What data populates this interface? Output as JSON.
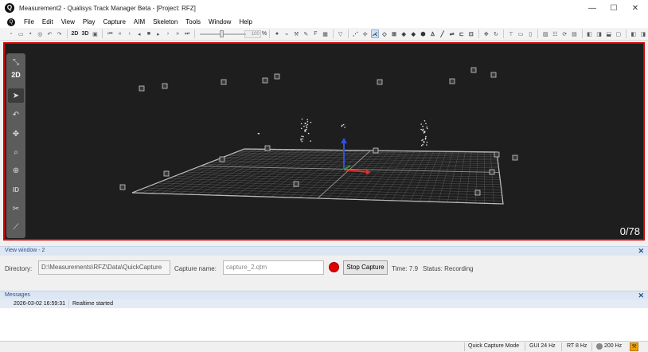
{
  "window": {
    "title": "Measurement2 - Qualisys Track Manager Beta - [Project: RFZ]",
    "minimize_glyph": "—",
    "maximize_glyph": "☐",
    "close_glyph": "✕"
  },
  "menu": {
    "items": [
      "File",
      "Edit",
      "View",
      "Play",
      "Capture",
      "AIM",
      "Skeleton",
      "Tools",
      "Window",
      "Help"
    ]
  },
  "toolbar": {
    "mode_2d": "2D",
    "mode_3d": "3D",
    "zoom_value": "100",
    "zoom_unit": "%"
  },
  "viewport": {
    "frame_counter": "0/78",
    "side_tools": {
      "label_2d": "2D",
      "label_id": "ID"
    },
    "colors": {
      "background": "#1e1e1e",
      "border": "#e00000",
      "grid": "#9a9a9a",
      "axis_x": "#e03030",
      "axis_y": "#2ca02c",
      "axis_z": "#3050e0"
    }
  },
  "view_panel": {
    "title": "View window - 2",
    "close_glyph": "✕",
    "directory_label": "Directory:",
    "directory_value": "D:\\Measurements\\RFZ\\Data\\QuickCapture",
    "capture_name_label": "Capture name:",
    "capture_name_value": "capture_2.qtm",
    "stop_button": "Stop Capture",
    "time": "Time: 7.9",
    "status": "Status: Recording"
  },
  "messages_panel": {
    "title": "Messages",
    "close_glyph": "✕",
    "rows": [
      {
        "time": "2026-03-02 16:59:31",
        "text": "Realtime started"
      }
    ]
  },
  "statusbar": {
    "mode": "Quick Capture Mode",
    "gui_rate": "GUI 24 Hz",
    "rt_rate": "RT 8 Hz",
    "capture_rate": "200 Hz"
  }
}
